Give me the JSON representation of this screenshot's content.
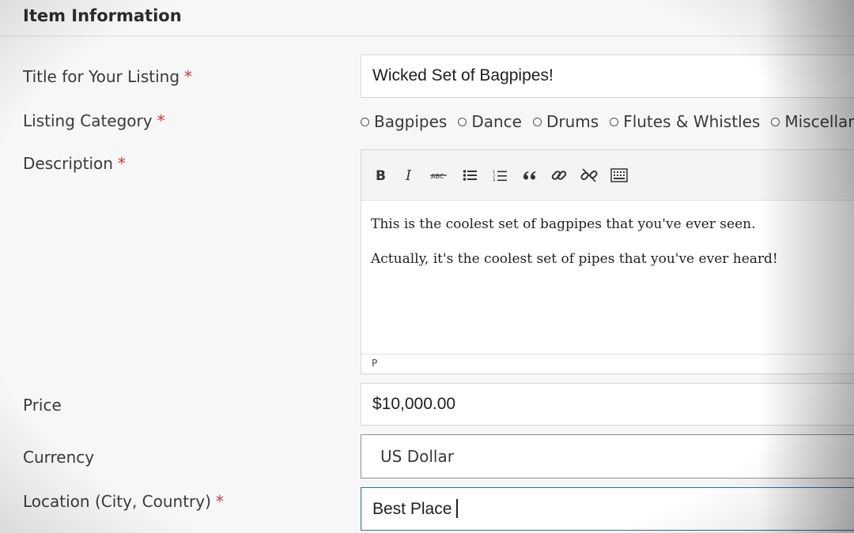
{
  "section": {
    "title": "Item Information"
  },
  "required_marker": "*",
  "title_field": {
    "label": "Title for Your Listing",
    "value": "Wicked Set of Bagpipes!"
  },
  "category": {
    "label": "Listing Category",
    "options": [
      "Bagpipes",
      "Dance",
      "Drums",
      "Flutes & Whistles",
      "Miscellan"
    ]
  },
  "description": {
    "label": "Description",
    "toolbar": [
      "bold-icon",
      "italic-icon",
      "strikethrough-icon",
      "bulleted-list-icon",
      "numbered-list-icon",
      "blockquote-icon",
      "insert-link-icon",
      "remove-link-icon",
      "toolbar-toggle-icon"
    ],
    "paragraphs": [
      "This is the coolest set of bagpipes that you've ever seen.",
      "Actually, it's the coolest set of pipes that you've ever heard!"
    ],
    "status_path": "P"
  },
  "price": {
    "label": "Price",
    "value": "$10,000.00"
  },
  "currency": {
    "label": "Currency",
    "value": "US Dollar"
  },
  "location": {
    "label": "Location (City, Country)",
    "value": "Best Place"
  },
  "colors": {
    "required": "#d63638",
    "focus_border": "#2271b1"
  }
}
